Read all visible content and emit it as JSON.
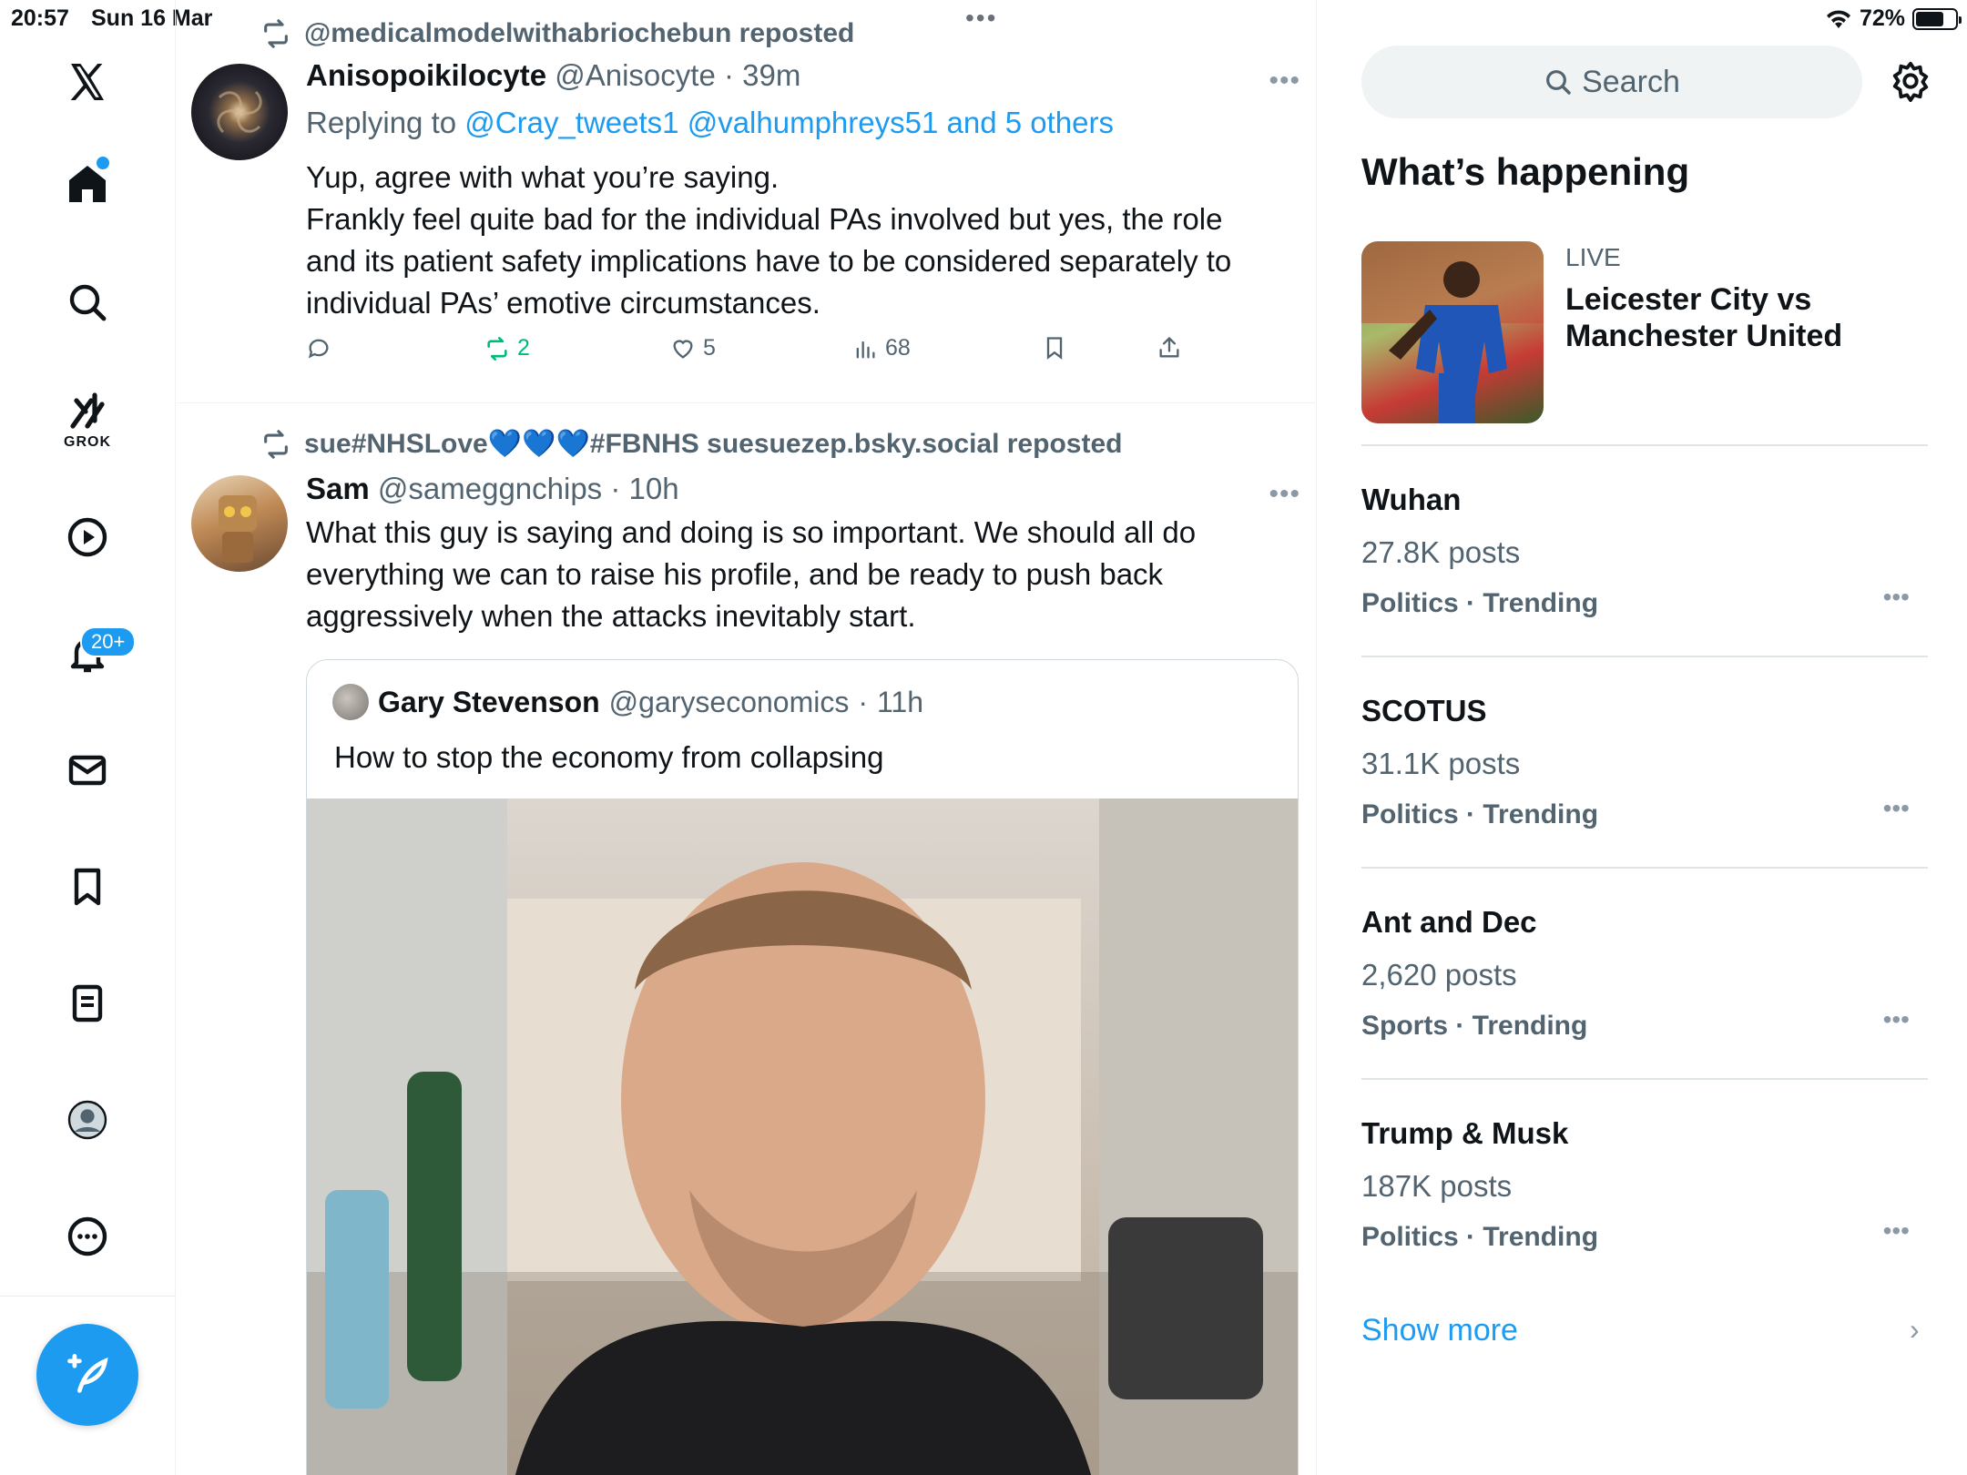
{
  "status_bar": {
    "time": "20:57",
    "date": "Sun 16 Mar",
    "battery": "72%",
    "battery_level": 0.72
  },
  "nav": {
    "items": [
      "x-logo",
      "home",
      "search",
      "grok",
      "videos",
      "notifications",
      "messages",
      "bookmarks",
      "lists",
      "profile",
      "more"
    ],
    "grok_label": "GROK",
    "notif_badge": "20+"
  },
  "feed": {
    "posts": [
      {
        "repost_by": "@medicalmodelwithabriochebun reposted",
        "name": "Anisopoikilocyte",
        "handle": "@Anisocyte",
        "time": "39m",
        "replying_prefix": "Replying to ",
        "replying_to": "@Cray_tweets1 @valhumphreys51 and 5 others",
        "text_lines": [
          "Yup, agree with  what you’re saying.",
          "Frankly feel quite bad for the individual PAs involved but yes, the role",
          "and its patient safety implications have to be considered separately to",
          "individual PAs’ emotive circumstances."
        ],
        "actions": {
          "replies": "",
          "reposts": "2",
          "likes": "5",
          "views": "68"
        }
      },
      {
        "repost_by": "sue#NHSLove💙💙💙#FBNHS suesuezep.bsky.social reposted",
        "name": "Sam",
        "handle": "@sameggnchips",
        "time": "10h",
        "text_lines": [
          "What this guy is saying and doing is so important. We should all do",
          "everything we can to raise his profile, and be ready to push back",
          "aggressively when the attacks inevitably start."
        ],
        "quote": {
          "name": "Gary Stevenson",
          "handle": "@garyseconomics",
          "time": "11h",
          "text": "How to stop the economy from collapsing"
        }
      }
    ]
  },
  "sidebar": {
    "search_placeholder": "Search",
    "title": "What’s happening",
    "live": {
      "tag": "LIVE",
      "title": "Leicester City vs Manchester United"
    },
    "trends": [
      {
        "name": "Wuhan",
        "count": "27.8K posts",
        "category": "Politics · Trending"
      },
      {
        "name": "SCOTUS",
        "count": "31.1K posts",
        "category": "Politics · Trending"
      },
      {
        "name": "Ant and Dec",
        "count": "2,620 posts",
        "category": "Sports · Trending"
      },
      {
        "name": "Trump & Musk",
        "count": "187K posts",
        "category": "Politics · Trending"
      }
    ],
    "show_more": "Show more"
  },
  "colors": {
    "accent": "#1d9bf0",
    "repost_green": "#00ba7c",
    "muted": "#536471"
  }
}
